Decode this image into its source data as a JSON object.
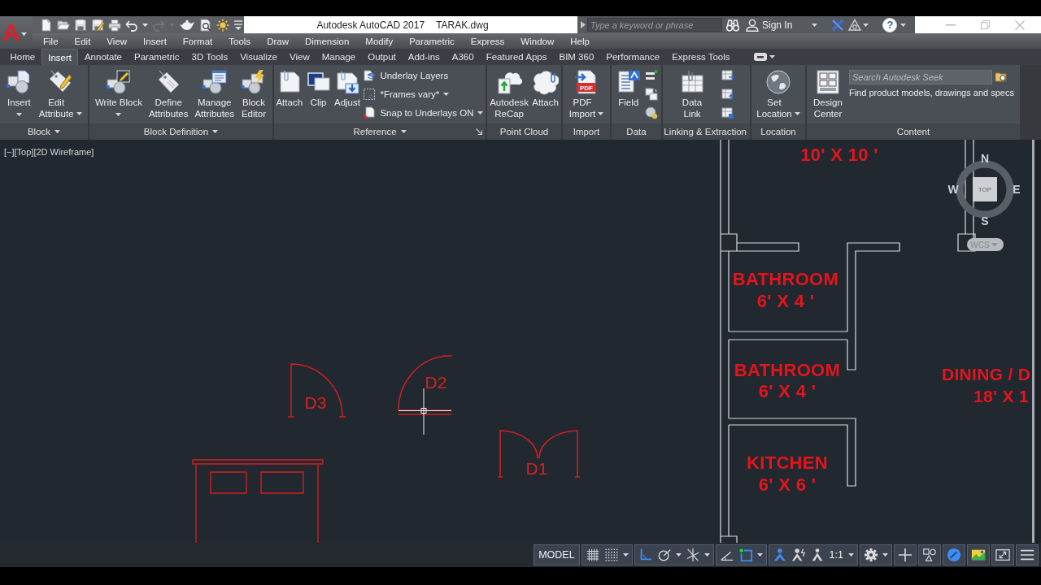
{
  "title_bar": {
    "app_logo": "A",
    "quick_access": [
      {
        "disabled": false
      },
      {
        "disabled": false
      },
      {
        "disabled": false
      },
      {
        "disabled": false
      },
      {
        "disabled": false
      },
      {
        "disabled": false
      },
      {
        "disabled": false
      },
      {
        "disabled": true
      },
      {
        "disabled": true
      },
      {
        "disabled": false
      },
      {
        "disabled": false
      },
      {
        "disabled": false
      },
      {
        "disabled": false
      }
    ],
    "app_title": "Autodesk AutoCAD 2017",
    "file_name": "TARAK.dwg",
    "search": {
      "placeholder": "Type a keyword or phrase"
    },
    "sign_in": "Sign In",
    "help": "?"
  },
  "menu_bar": [
    "File",
    "Edit",
    "View",
    "Insert",
    "Format",
    "Tools",
    "Draw",
    "Dimension",
    "Modify",
    "Parametric",
    "Express",
    "Window",
    "Help"
  ],
  "ribbon_tabs": [
    {
      "label": "Home",
      "selected": false
    },
    {
      "label": "Insert",
      "selected": true
    },
    {
      "label": "Annotate",
      "selected": false
    },
    {
      "label": "Parametric",
      "selected": false
    },
    {
      "label": "3D Tools",
      "selected": false
    },
    {
      "label": "Visualize",
      "selected": false
    },
    {
      "label": "View",
      "selected": false
    },
    {
      "label": "Manage",
      "selected": false
    },
    {
      "label": "Output",
      "selected": false
    },
    {
      "label": "Add-ins",
      "selected": false
    },
    {
      "label": "A360",
      "selected": false
    },
    {
      "label": "Featured Apps",
      "selected": false
    },
    {
      "label": "BIM 360",
      "selected": false
    },
    {
      "label": "Performance",
      "selected": false
    },
    {
      "label": "Express Tools",
      "selected": false
    }
  ],
  "ribbon_panels": [
    {
      "title": "Block",
      "title_menu": true,
      "tools": [
        {
          "kind": "large",
          "label": "Insert",
          "dropdown": true
        },
        {
          "kind": "large",
          "label": "Edit\nAttribute",
          "dropdown": true
        }
      ]
    },
    {
      "title": "Block Definition",
      "title_menu": true,
      "tools": [
        {
          "kind": "large",
          "label": "Write Block",
          "dropdown": true
        },
        {
          "kind": "large",
          "label": "Define\nAttributes",
          "dropdown": false
        },
        {
          "kind": "large",
          "label": "Manage\nAttributes",
          "dropdown": false
        },
        {
          "kind": "large",
          "label": "Block\nEditor",
          "dropdown": false
        }
      ]
    },
    {
      "title": "Reference",
      "title_menu": true,
      "launcher": true,
      "tools": [
        {
          "kind": "large",
          "label": "Attach",
          "dropdown": false
        },
        {
          "kind": "large",
          "label": "Clip",
          "dropdown": false
        },
        {
          "kind": "large",
          "label": "Adjust",
          "dropdown": false
        },
        {
          "kind": "small",
          "label": "Underlay Layers",
          "dropdown": false
        },
        {
          "kind": "small",
          "label": "*Frames vary*",
          "dropdown": true
        },
        {
          "kind": "small",
          "label": "Snap to Underlays ON",
          "dropdown": true
        }
      ]
    },
    {
      "title": "Point Cloud",
      "title_menu": false,
      "tools": [
        {
          "kind": "large",
          "label": "Autodesk\nReCap",
          "dropdown": false
        },
        {
          "kind": "large",
          "label": "Attach",
          "dropdown": false
        }
      ]
    },
    {
      "title": "Import",
      "title_menu": false,
      "tools": [
        {
          "kind": "large",
          "label": "PDF\nImport",
          "dropdown": true,
          "icon_text": "PDF"
        }
      ]
    },
    {
      "title": "Data",
      "title_menu": false,
      "tools": [
        {
          "kind": "large",
          "label": "Field",
          "dropdown": false
        },
        {
          "kind": "icon"
        },
        {
          "kind": "icon"
        },
        {
          "kind": "icon"
        }
      ]
    },
    {
      "title": "Linking & Extraction",
      "title_menu": false,
      "tools": [
        {
          "kind": "large",
          "label": "Data\nLink",
          "dropdown": false
        },
        {
          "kind": "icon"
        },
        {
          "kind": "icon"
        },
        {
          "kind": "icon"
        }
      ]
    },
    {
      "title": "Location",
      "title_menu": false,
      "tools": [
        {
          "kind": "large",
          "label": "Set\nLocation",
          "dropdown": true
        }
      ]
    },
    {
      "title": "Content",
      "title_menu": false,
      "tools": [
        {
          "kind": "large",
          "label": "Design\nCenter",
          "dropdown": false
        },
        {
          "kind": "search",
          "placeholder": "Search Autodesk Seek",
          "hint": "Find product models, drawings and specs"
        }
      ]
    }
  ],
  "viewport": {
    "view_controls": [
      "[−]",
      "[Top]",
      "[2D Wireframe]"
    ],
    "room_labels": [
      {
        "size": "10' X 10 '"
      },
      {
        "name": "BATHROOM",
        "size": "6' X 4 '"
      },
      {
        "name": "BATHROOM",
        "size": "6' X 4 '"
      },
      {
        "name": "KITCHEN",
        "size": "6' X 6 '"
      },
      {
        "name": "DINING / D",
        "size": "18' X 1"
      }
    ],
    "doors": [
      {
        "label": "D3"
      },
      {
        "label": "D2"
      },
      {
        "label": "D1"
      }
    ],
    "viewcube": {
      "face": "TOP",
      "north": "N",
      "east": "E",
      "south": "S",
      "west": "W",
      "ucs": "WCS"
    }
  },
  "status_bar": {
    "space": "MODEL",
    "toggles": [
      {
        "on": false
      },
      {
        "on": false
      },
      {
        "on": true
      },
      {
        "on": false
      },
      {
        "on": false
      },
      {
        "on": false
      },
      {
        "on": true
      },
      {
        "on": true
      },
      {
        "on": false
      },
      {
        "on": true
      }
    ],
    "scale": "1:1"
  }
}
